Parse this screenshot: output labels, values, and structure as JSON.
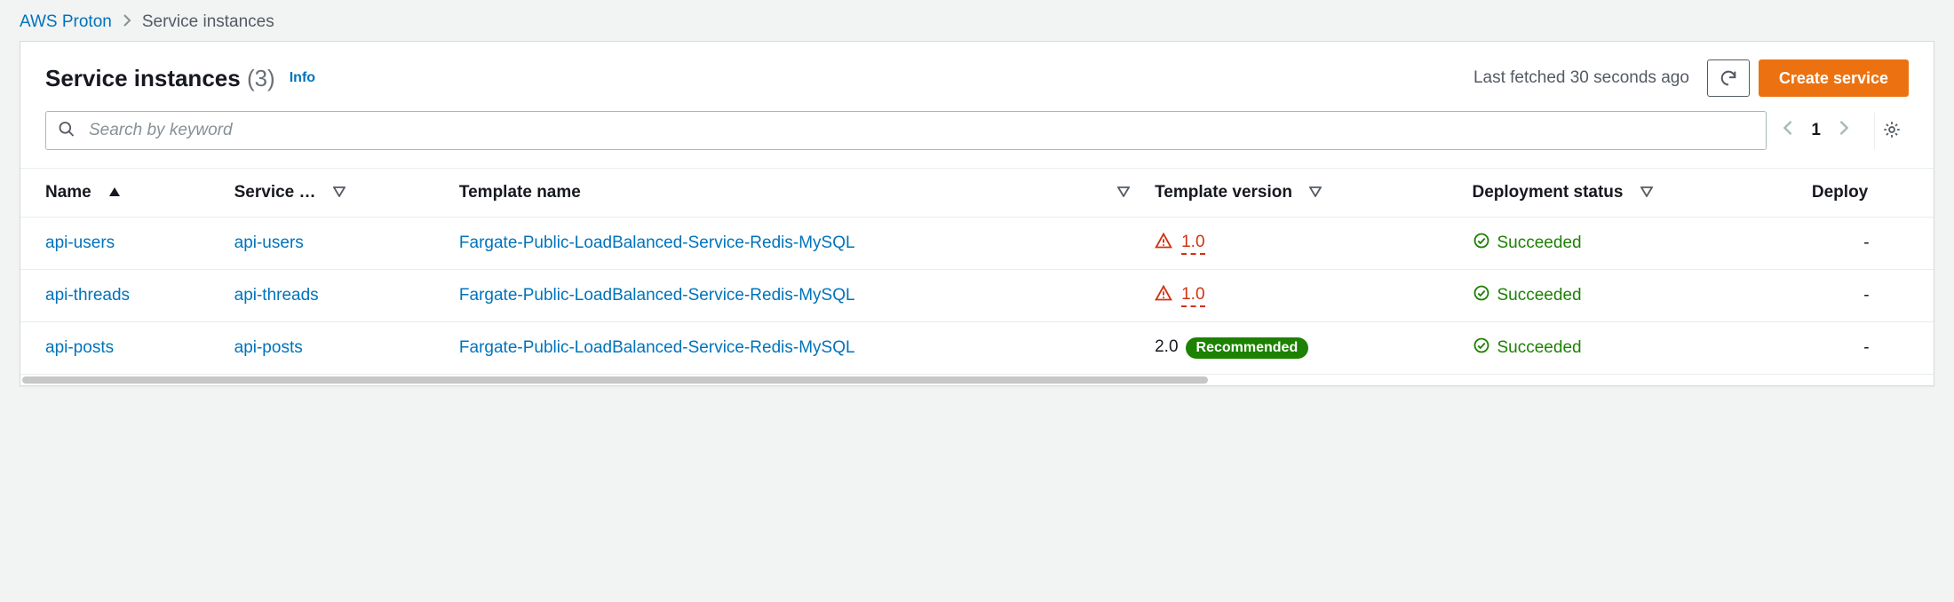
{
  "breadcrumb": {
    "root": "AWS Proton",
    "current": "Service instances"
  },
  "header": {
    "title": "Service instances",
    "count": "(3)",
    "info": "Info",
    "last_fetched": "Last fetched 30 seconds ago",
    "create_button": "Create service"
  },
  "search": {
    "placeholder": "Search by keyword"
  },
  "pagination": {
    "page": "1"
  },
  "columns": {
    "name": "Name",
    "service": "Service …",
    "template_name": "Template name",
    "template_version": "Template version",
    "deployment_status": "Deployment status",
    "deployed": "Deploy"
  },
  "labels": {
    "recommended": "Recommended",
    "succeeded": "Succeeded",
    "dash": "-"
  },
  "rows": [
    {
      "name": "api-users",
      "service": "api-users",
      "template_name": "Fargate-Public-LoadBalanced-Service-Redis-MySQL",
      "version": "1.0",
      "version_outdated": true,
      "status": "Succeeded"
    },
    {
      "name": "api-threads",
      "service": "api-threads",
      "template_name": "Fargate-Public-LoadBalanced-Service-Redis-MySQL",
      "version": "1.0",
      "version_outdated": true,
      "status": "Succeeded"
    },
    {
      "name": "api-posts",
      "service": "api-posts",
      "template_name": "Fargate-Public-LoadBalanced-Service-Redis-MySQL",
      "version": "2.0",
      "version_outdated": false,
      "status": "Succeeded"
    }
  ]
}
